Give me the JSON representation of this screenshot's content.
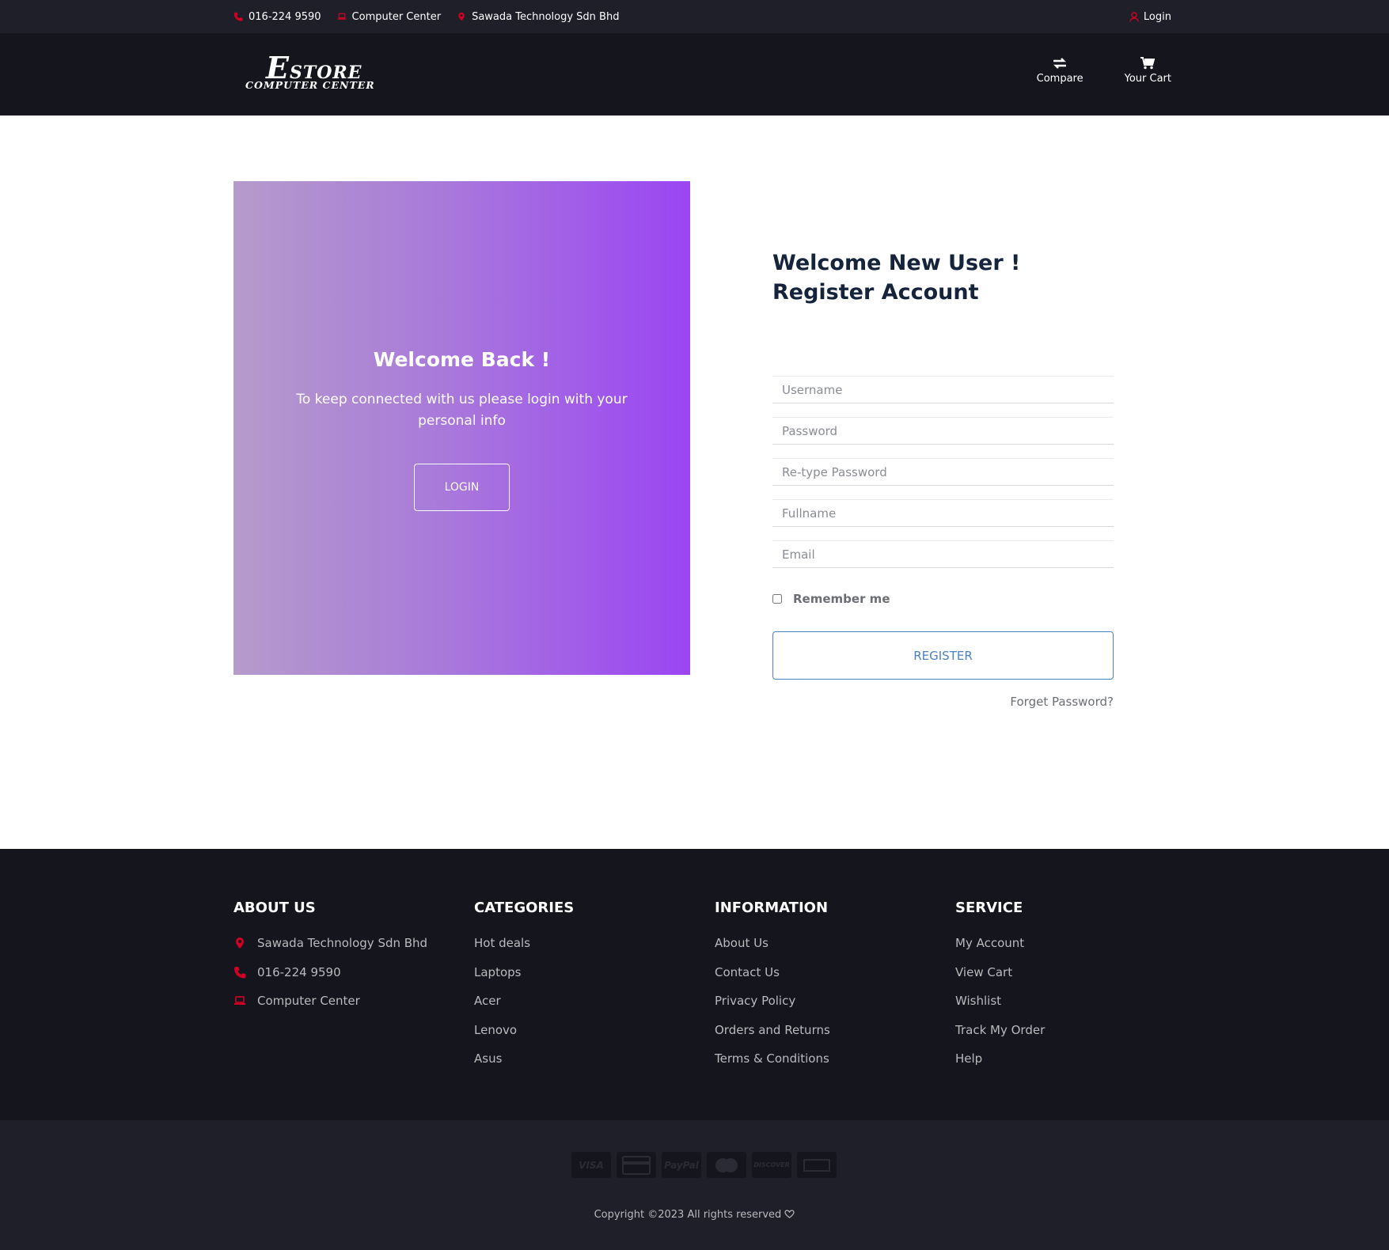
{
  "topbar": {
    "phone": "016-224 9590",
    "store_name": "Computer Center",
    "company": "Sawada Technology Sdn Bhd",
    "login_label": "Login"
  },
  "header": {
    "logo_big_letter": "E",
    "logo_brand": "STORE",
    "logo_sub": "COMPUTER CENTER",
    "compare_label": "Compare",
    "cart_label": "Your Cart"
  },
  "welcome_panel": {
    "title": "Welcome Back !",
    "text": "To keep connected with us please login with your personal info",
    "login_button": "LOGIN"
  },
  "register": {
    "title_line1": "Welcome New User !",
    "title_line2": "Register Account",
    "fields": {
      "username": "Username",
      "password": "Password",
      "retype": "Re-type Password",
      "fullname": "Fullname",
      "email": "Email"
    },
    "remember_label": "Remember me",
    "register_button": "REGISTER",
    "forgot_link": "Forget Password?"
  },
  "footer": {
    "about": {
      "title": "ABOUT US",
      "items": [
        "Sawada Technology Sdn Bhd",
        "016-224 9590",
        "Computer Center"
      ]
    },
    "categories": {
      "title": "CATEGORIES",
      "items": [
        "Hot deals",
        "Laptops",
        "Acer",
        "Lenovo",
        "Asus"
      ]
    },
    "information": {
      "title": "INFORMATION",
      "items": [
        "About Us",
        "Contact Us",
        "Privacy Policy",
        "Orders and Returns",
        "Terms & Conditions"
      ]
    },
    "service": {
      "title": "SERVICE",
      "items": [
        "My Account",
        "View Cart",
        "Wishlist",
        "Track My Order",
        "Help"
      ]
    }
  },
  "payment_methods": [
    "VISA",
    "",
    "PayPal",
    "",
    "DISCOVER",
    ""
  ],
  "copyright": "Copyright ©2023 All rights reserved",
  "colors": {
    "accent_red": "#d10024",
    "dark_bg": "#15161d",
    "topbar_bg": "#1e1f29",
    "register_blue": "#4a83c4",
    "gradient_start": "#b59bcb",
    "gradient_end": "#9b45f3"
  }
}
